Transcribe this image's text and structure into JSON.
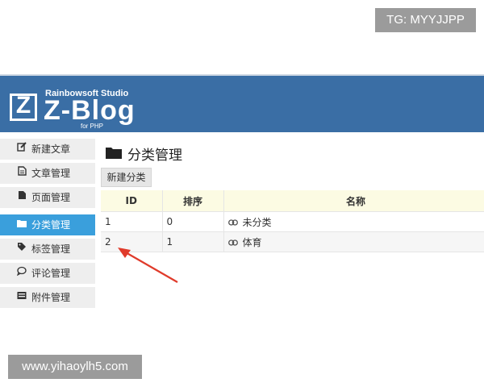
{
  "watermarks": {
    "top": "TG: MYYJJPP",
    "bottom": "www.yihaoylh5.com"
  },
  "header": {
    "logo_letter": "Z",
    "studio": "Rainbowsoft Studio",
    "brand": "Z-Blog",
    "sub": "for PHP",
    "bg_color": "#3a6ea5"
  },
  "sidebar": {
    "items": [
      {
        "label": "新建文章",
        "icon": "edit-icon",
        "active": false
      },
      {
        "label": "文章管理",
        "icon": "document-icon",
        "active": false
      },
      {
        "label": "页面管理",
        "icon": "page-icon",
        "active": false
      },
      {
        "label": "分类管理",
        "icon": "folder-icon",
        "active": true
      },
      {
        "label": "标签管理",
        "icon": "tag-icon",
        "active": false
      },
      {
        "label": "评论管理",
        "icon": "comment-icon",
        "active": false
      },
      {
        "label": "附件管理",
        "icon": "attachment-icon",
        "active": false
      }
    ],
    "active_color": "#3a9fdc"
  },
  "main": {
    "title": "分类管理",
    "new_button": "新建分类",
    "table": {
      "headers": [
        "ID",
        "排序",
        "名称"
      ],
      "rows": [
        {
          "id": "1",
          "order": "0",
          "name": "未分类"
        },
        {
          "id": "2",
          "order": "1",
          "name": "体育"
        }
      ]
    }
  },
  "annotation": {
    "arrow_color": "#e03b2b"
  }
}
